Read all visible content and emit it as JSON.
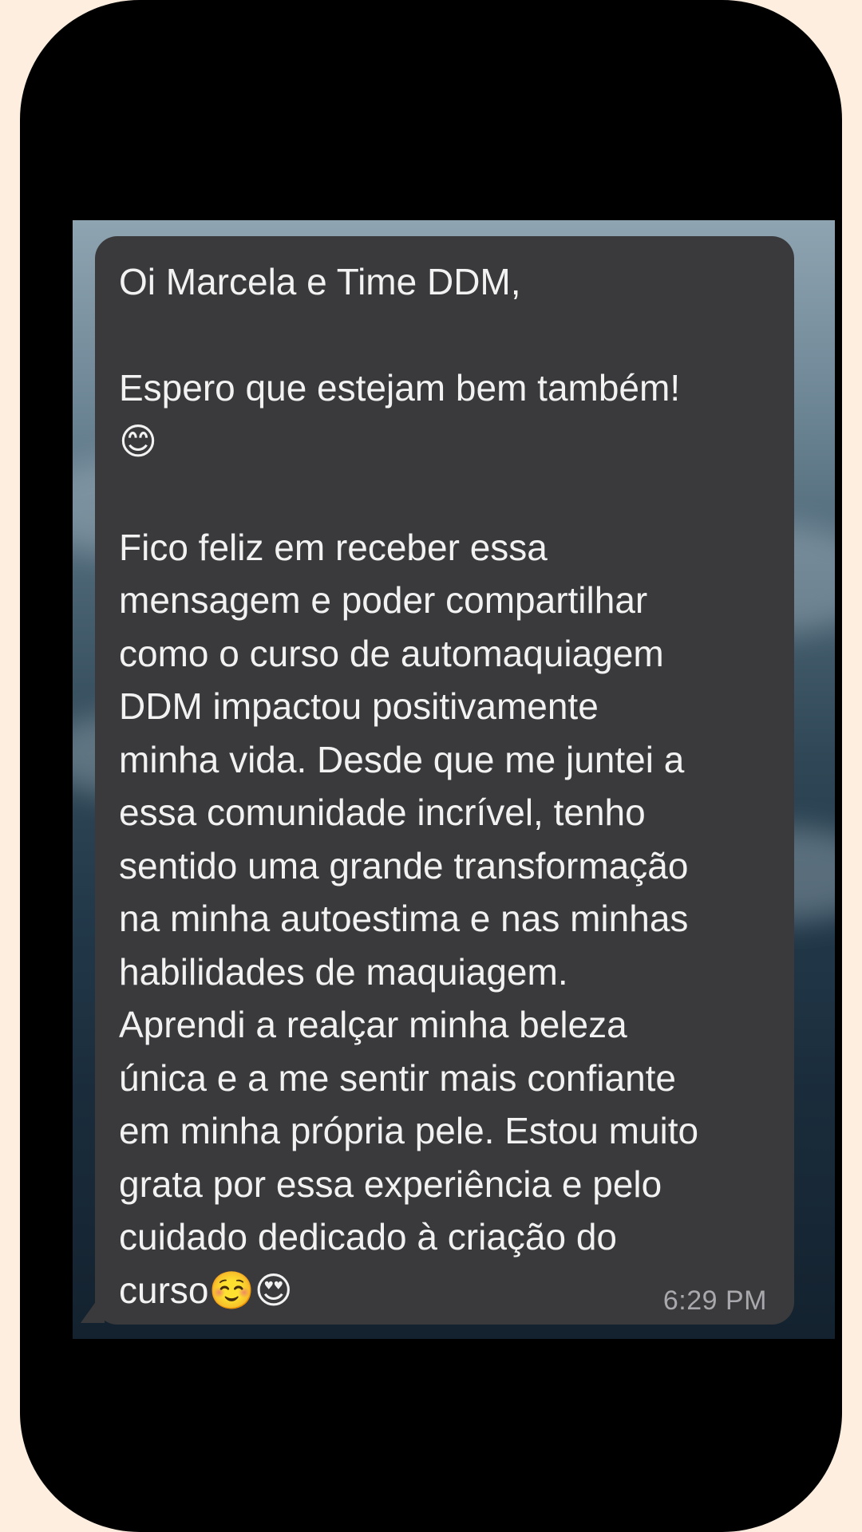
{
  "message": {
    "text": "Oi Marcela e Time DDM,\n\nEspero que estejam bem também!\n😊\n\nFico feliz em receber essa\nmensagem e poder compartilhar\ncomo o curso de automaquiagem\nDDM impactou positivamente\nminha vida. Desde que me juntei a\nessa comunidade incrível, tenho\nsentido uma grande transformação\nna minha autoestima e nas minhas\nhabilidades de maquiagem.\nAprendi a realçar minha beleza\núnica e a me sentir mais confiante\nem minha própria pele. Estou muito\ngrata por essa experiência e pelo\ncuidado dedicado à criação do\ncurso☺️😍",
    "time": "6:29 PM"
  },
  "colors": {
    "page_background": "#fdeee0",
    "frame": "#000000",
    "bubble": "#3a3a3c",
    "text": "#f2f2f2",
    "timestamp": "#a9a9ad"
  }
}
